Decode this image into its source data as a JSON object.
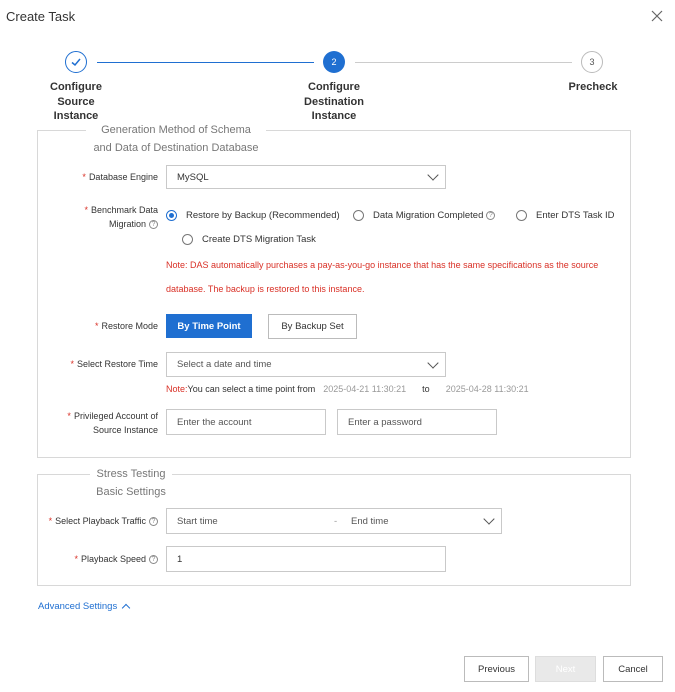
{
  "dialog": {
    "title": "Create Task"
  },
  "steps": [
    {
      "number": "1",
      "label": "Configure\nSource\nInstance",
      "state": "done"
    },
    {
      "number": "2",
      "label": "Configure\nDestination\nInstance",
      "state": "active"
    },
    {
      "number": "3",
      "label": "Precheck",
      "state": "pending"
    }
  ],
  "section1": {
    "legend": "Generation Method of Schema\nand Data of Destination Database",
    "database_engine": {
      "label": "Database Engine",
      "value": "MySQL"
    },
    "benchmark": {
      "label_line1": "Benchmark Data",
      "label_line2": "Migration",
      "options": [
        "Restore by Backup (Recommended)",
        "Data Migration Completed",
        "Enter DTS Task ID",
        "Create DTS Migration Task"
      ],
      "selected": "Restore by Backup (Recommended)"
    },
    "note_line1": "Note: DAS automatically purchases a pay-as-you-go instance that has the same specifications as the source",
    "note_line2": "database. The backup is restored to this instance.",
    "restore_mode": {
      "label": "Restore Mode",
      "options": [
        "By Time Point",
        "By Backup Set"
      ],
      "selected": "By Time Point"
    },
    "restore_time": {
      "label": "Select Restore Time",
      "placeholder": "Select a date and time",
      "note_prefix": "Note:",
      "note_text": "You can select a time point from",
      "from": "2025-04-21 11:30:21",
      "to_word": "to",
      "to": "2025-04-28 11:30:21"
    },
    "privileged_account": {
      "label_line1": "Privileged Account of",
      "label_line2": "Source Instance",
      "account_placeholder": "Enter the account",
      "password_placeholder": "Enter a password"
    }
  },
  "section2": {
    "legend": "Stress Testing\nBasic Settings",
    "playback_traffic": {
      "label": "Select Playback Traffic",
      "start_placeholder": "Start time",
      "separator": "-",
      "end_placeholder": "End time"
    },
    "playback_speed": {
      "label": "Playback Speed",
      "value": "1"
    }
  },
  "advanced_settings": "Advanced Settings",
  "footer": {
    "previous": "Previous",
    "next": "Next",
    "cancel": "Cancel"
  },
  "colors": {
    "accent": "#1f6fd1",
    "required": "#d93026"
  }
}
